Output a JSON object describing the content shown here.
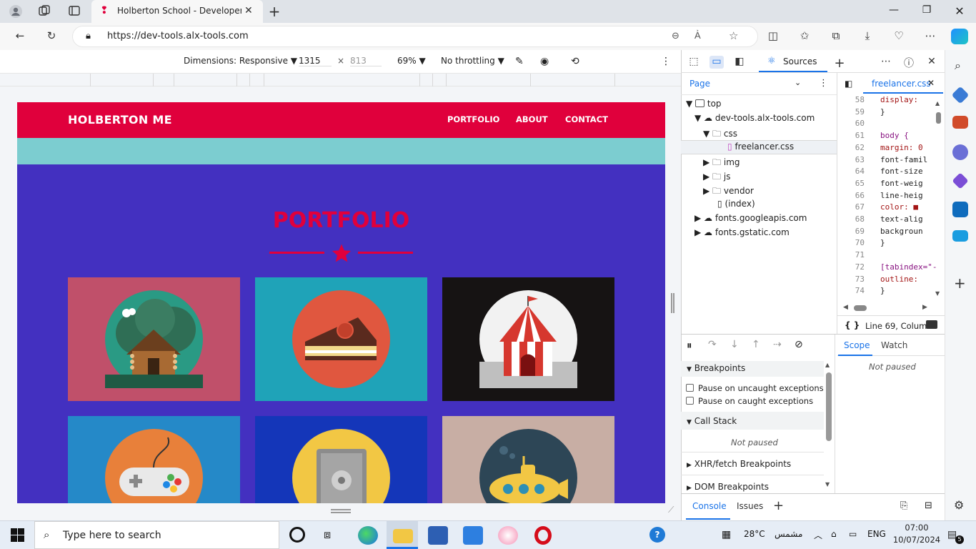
{
  "browser": {
    "tab_title": "Holberton School - Developer to",
    "url": "https://dev-tools.alx-tools.com"
  },
  "device_toolbar": {
    "dimensions": "Dimensions: Responsive",
    "width": "1315",
    "height": "813",
    "times": "×",
    "zoom": "69%",
    "throttling": "No throttling"
  },
  "site": {
    "brand": "HOLBERTON ME",
    "nav": [
      "PORTFOLIO",
      "ABOUT",
      "CONTACT"
    ],
    "section_title": "PORTFOLIO",
    "colors": {
      "nav": "#e0003c",
      "teal": "#7ccdd0",
      "section_bg": "#4330c0"
    },
    "portfolio_items": [
      {
        "icon": "cabin-icon",
        "bg": "#c0506a"
      },
      {
        "icon": "cake-icon",
        "bg": "#1fa3b8"
      },
      {
        "icon": "circus-tent-icon",
        "bg": "#161313"
      },
      {
        "icon": "game-controller-icon",
        "bg": "#2589c8"
      },
      {
        "icon": "safe-icon",
        "bg": "#1436b9"
      },
      {
        "icon": "submarine-icon",
        "bg": "#c8aea4"
      }
    ]
  },
  "devtools": {
    "sources_tab": "Sources",
    "page_tab": "Page",
    "file_tab": "freelancer.css",
    "tree": [
      "top",
      "dev-tools.alx-tools.com",
      "css",
      "freelancer.css",
      "img",
      "js",
      "vendor",
      "(index)",
      "fonts.googleapis.com",
      "fonts.gstatic.com"
    ],
    "code_lines": [
      {
        "n": "58",
        "t": "  display: "
      },
      {
        "n": "59",
        "t": "}"
      },
      {
        "n": "60",
        "t": ""
      },
      {
        "n": "61",
        "t": "body {"
      },
      {
        "n": "62",
        "t": "  margin: 0"
      },
      {
        "n": "63",
        "t": "  font-famil"
      },
      {
        "n": "64",
        "t": "  font-size"
      },
      {
        "n": "65",
        "t": "  font-weig"
      },
      {
        "n": "66",
        "t": "  line-heig"
      },
      {
        "n": "67",
        "t": "  color: ■"
      },
      {
        "n": "68",
        "t": "  text-alig"
      },
      {
        "n": "69",
        "t": "  backgroun"
      },
      {
        "n": "70",
        "t": "}"
      },
      {
        "n": "71",
        "t": ""
      },
      {
        "n": "72",
        "t": "[tabindex=\"-"
      },
      {
        "n": "73",
        "t": "  outline: "
      },
      {
        "n": "74",
        "t": "}"
      }
    ],
    "status": "Line 69, Column",
    "braces": "{ }",
    "scope_tab": "Scope",
    "watch_tab": "Watch",
    "not_paused": "Not paused",
    "breakpoints": "Breakpoints",
    "pause_uncaught": "Pause on uncaught exceptions",
    "pause_caught": "Pause on caught exceptions",
    "call_stack": "Call Stack",
    "xhr": "XHR/fetch Breakpoints",
    "dom": "DOM Breakpoints",
    "console_tab": "Console",
    "issues_tab": "Issues"
  },
  "taskbar": {
    "search_placeholder": "Type here to search",
    "temperature": "28°C",
    "weather_text": "مشمس",
    "lang": "ENG",
    "time": "07:00",
    "date": "10/07/2024",
    "notif_count": "5"
  }
}
